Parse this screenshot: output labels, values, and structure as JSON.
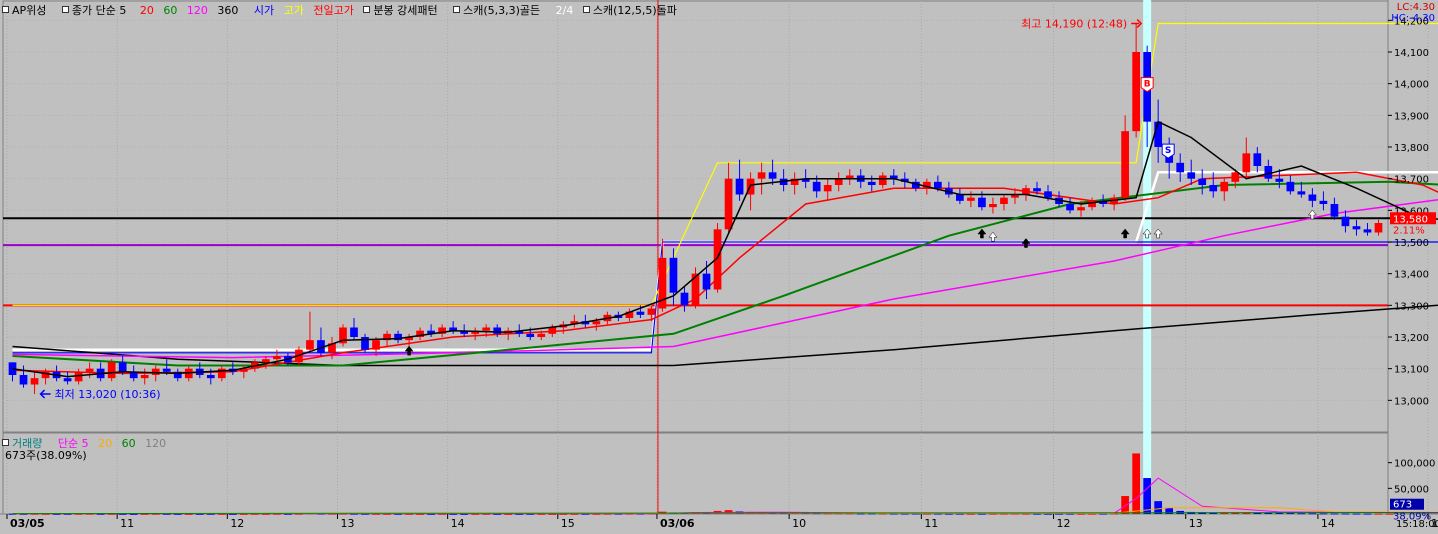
{
  "legend": {
    "indicator": "AP위성",
    "ma_label": "종가 단순 5",
    "ma20": "20",
    "ma60": "60",
    "ma120": "120",
    "ma360": "360",
    "open": "시가",
    "high": "고가",
    "prev_high": "전일고가",
    "pattern": "분봉 강세패턴",
    "scan1": "스캐(5,3,3)골든",
    "scan1_count": "2/4",
    "scan2": "스캐(12,5,5)돌파"
  },
  "right_info": {
    "lc": "LC:4.30",
    "hc": "HC:-4.30"
  },
  "colors": {
    "ma5": "#000000",
    "ma20": "#ff0000",
    "ma60": "#008000",
    "ma120": "#ff00ff",
    "ma360": "#000000",
    "open": "#0000ff",
    "high": "#ffff00",
    "prev_high": "#ff0000",
    "up": "#ff0000",
    "down": "#0000ff",
    "volume_label": "#008080"
  },
  "annotations": {
    "high_label": "최고 14,190 (12:48)",
    "low_label": "최저 13,020 (10:36)"
  },
  "markers": {
    "buy": "B",
    "sell": "S"
  },
  "current": {
    "price": "13,580",
    "change": "2.11%"
  },
  "volume_legend": {
    "title": "거래량",
    "ma_label": "단순 5",
    "ma20": "20",
    "ma60": "60",
    "ma120": "120"
  },
  "volume_info": "673주(38.09%)",
  "volume_current": {
    "value": "673",
    "pct": "38.09%"
  },
  "time_axis": {
    "end": "15:18:00"
  },
  "chart_data": [
    {
      "type": "candlestick",
      "x_labels": [
        "03/05",
        "11",
        "12",
        "13",
        "14",
        "15",
        "03/06",
        "10",
        "11",
        "12",
        "13",
        "14",
        "15"
      ],
      "y_ticks": [
        "14,200",
        "14,100",
        "14,000",
        "13,900",
        "13,800",
        "13,700",
        "13,600",
        "13,500",
        "13,400",
        "13,300",
        "13,200",
        "13,100",
        "13,000"
      ],
      "ylim": [
        12900,
        14220
      ],
      "candles": [
        [
          13120,
          13120,
          13060,
          13080
        ],
        [
          13080,
          13110,
          13040,
          13050
        ],
        [
          13050,
          13090,
          13020,
          13070
        ],
        [
          13070,
          13100,
          13050,
          13090
        ],
        [
          13090,
          13110,
          13060,
          13070
        ],
        [
          13070,
          13090,
          13050,
          13060
        ],
        [
          13060,
          13100,
          13050,
          13090
        ],
        [
          13090,
          13120,
          13070,
          13100
        ],
        [
          13100,
          13120,
          13060,
          13070
        ],
        [
          13070,
          13130,
          13060,
          13120
        ],
        [
          13120,
          13140,
          13080,
          13090
        ],
        [
          13090,
          13110,
          13060,
          13070
        ],
        [
          13070,
          13100,
          13050,
          13080
        ],
        [
          13080,
          13110,
          13060,
          13100
        ],
        [
          13100,
          13130,
          13080,
          13090
        ],
        [
          13090,
          13100,
          13060,
          13070
        ],
        [
          13070,
          13110,
          13060,
          13100
        ],
        [
          13100,
          13120,
          13070,
          13080
        ],
        [
          13080,
          13100,
          13050,
          13070
        ],
        [
          13070,
          13110,
          13060,
          13100
        ],
        [
          13100,
          13120,
          13080,
          13090
        ],
        [
          13090,
          13110,
          13070,
          13100
        ],
        [
          13100,
          13130,
          13090,
          13120
        ],
        [
          13120,
          13140,
          13100,
          13130
        ],
        [
          13130,
          13160,
          13110,
          13140
        ],
        [
          13140,
          13150,
          13110,
          13120
        ],
        [
          13120,
          13170,
          13110,
          13160
        ],
        [
          13160,
          13280,
          13150,
          13190
        ],
        [
          13190,
          13230,
          13140,
          13150
        ],
        [
          13150,
          13200,
          13130,
          13180
        ],
        [
          13180,
          13240,
          13170,
          13230
        ],
        [
          13230,
          13260,
          13190,
          13200
        ],
        [
          13200,
          13210,
          13150,
          13160
        ],
        [
          13160,
          13200,
          13140,
          13190
        ],
        [
          13190,
          13220,
          13170,
          13210
        ],
        [
          13210,
          13220,
          13180,
          13190
        ],
        [
          13190,
          13210,
          13170,
          13200
        ],
        [
          13200,
          13230,
          13190,
          13220
        ],
        [
          13220,
          13240,
          13200,
          13210
        ],
        [
          13210,
          13240,
          13200,
          13230
        ],
        [
          13230,
          13250,
          13210,
          13220
        ],
        [
          13220,
          13240,
          13200,
          13210
        ],
        [
          13210,
          13230,
          13190,
          13220
        ],
        [
          13220,
          13240,
          13200,
          13230
        ],
        [
          13230,
          13240,
          13200,
          13210
        ],
        [
          13210,
          13230,
          13190,
          13220
        ],
        [
          13220,
          13240,
          13200,
          13210
        ],
        [
          13210,
          13230,
          13190,
          13200
        ],
        [
          13200,
          13220,
          13190,
          13210
        ],
        [
          13210,
          13240,
          13200,
          13230
        ],
        [
          13230,
          13250,
          13210,
          13240
        ],
        [
          13240,
          13270,
          13230,
          13250
        ],
        [
          13250,
          13270,
          13230,
          13240
        ],
        [
          13240,
          13260,
          13220,
          13250
        ],
        [
          13250,
          13280,
          13240,
          13270
        ],
        [
          13270,
          13280,
          13250,
          13260
        ],
        [
          13260,
          13290,
          13250,
          13280
        ],
        [
          13280,
          13300,
          13260,
          13270
        ],
        [
          13270,
          13300,
          13250,
          13290
        ],
        [
          13290,
          13510,
          13280,
          13450
        ],
        [
          13450,
          13480,
          13300,
          13340
        ],
        [
          13340,
          13360,
          13280,
          13300
        ],
        [
          13300,
          13420,
          13290,
          13400
        ],
        [
          13400,
          13440,
          13320,
          13350
        ],
        [
          13350,
          13560,
          13340,
          13540
        ],
        [
          13540,
          13750,
          13530,
          13700
        ],
        [
          13700,
          13760,
          13630,
          13650
        ],
        [
          13650,
          13720,
          13600,
          13700
        ],
        [
          13700,
          13750,
          13650,
          13720
        ],
        [
          13720,
          13760,
          13680,
          13700
        ],
        [
          13700,
          13730,
          13660,
          13680
        ],
        [
          13680,
          13720,
          13650,
          13700
        ],
        [
          13700,
          13730,
          13670,
          13690
        ],
        [
          13690,
          13710,
          13640,
          13660
        ],
        [
          13660,
          13700,
          13630,
          13680
        ],
        [
          13680,
          13720,
          13660,
          13700
        ],
        [
          13700,
          13730,
          13680,
          13710
        ],
        [
          13710,
          13730,
          13670,
          13690
        ],
        [
          13690,
          13710,
          13660,
          13680
        ],
        [
          13680,
          13720,
          13670,
          13710
        ],
        [
          13710,
          13730,
          13680,
          13700
        ],
        [
          13700,
          13720,
          13670,
          13690
        ],
        [
          13690,
          13700,
          13660,
          13670
        ],
        [
          13670,
          13700,
          13650,
          13690
        ],
        [
          13690,
          13710,
          13660,
          13670
        ],
        [
          13670,
          13690,
          13640,
          13650
        ],
        [
          13650,
          13670,
          13620,
          13630
        ],
        [
          13630,
          13660,
          13610,
          13640
        ],
        [
          13640,
          13660,
          13600,
          13610
        ],
        [
          13610,
          13640,
          13590,
          13620
        ],
        [
          13620,
          13650,
          13600,
          13640
        ],
        [
          13640,
          13670,
          13620,
          13650
        ],
        [
          13650,
          13680,
          13630,
          13670
        ],
        [
          13670,
          13690,
          13650,
          13660
        ],
        [
          13660,
          13680,
          13630,
          13640
        ],
        [
          13640,
          13660,
          13610,
          13620
        ],
        [
          13620,
          13640,
          13590,
          13600
        ],
        [
          13600,
          13630,
          13580,
          13610
        ],
        [
          13610,
          13640,
          13600,
          13630
        ],
        [
          13630,
          13650,
          13610,
          13620
        ],
        [
          13620,
          13650,
          13600,
          13640
        ],
        [
          13640,
          13900,
          13630,
          13850
        ],
        [
          13850,
          14190,
          13830,
          14100
        ],
        [
          14100,
          14120,
          13800,
          13880
        ],
        [
          13880,
          13950,
          13750,
          13800
        ],
        [
          13800,
          13830,
          13700,
          13750
        ],
        [
          13750,
          13780,
          13690,
          13720
        ],
        [
          13720,
          13760,
          13680,
          13700
        ],
        [
          13700,
          13730,
          13650,
          13680
        ],
        [
          13680,
          13720,
          13640,
          13660
        ],
        [
          13660,
          13700,
          13630,
          13690
        ],
        [
          13690,
          13730,
          13670,
          13720
        ],
        [
          13720,
          13830,
          13700,
          13780
        ],
        [
          13780,
          13800,
          13720,
          13740
        ],
        [
          13740,
          13760,
          13690,
          13700
        ],
        [
          13700,
          13730,
          13670,
          13690
        ],
        [
          13690,
          13710,
          13650,
          13660
        ],
        [
          13660,
          13690,
          13640,
          13650
        ],
        [
          13650,
          13670,
          13610,
          13630
        ],
        [
          13630,
          13660,
          13600,
          13620
        ],
        [
          13620,
          13640,
          13570,
          13580
        ],
        [
          13580,
          13600,
          13530,
          13550
        ],
        [
          13550,
          13570,
          13520,
          13540
        ],
        [
          13540,
          13560,
          13520,
          13530
        ],
        [
          13530,
          13570,
          13520,
          13560
        ]
      ],
      "ma5": [
        [
          0,
          13100
        ],
        [
          5,
          13075
        ],
        [
          10,
          13090
        ],
        [
          15,
          13085
        ],
        [
          20,
          13095
        ],
        [
          25,
          13130
        ],
        [
          30,
          13190
        ],
        [
          35,
          13195
        ],
        [
          40,
          13220
        ],
        [
          45,
          13215
        ],
        [
          50,
          13235
        ],
        [
          55,
          13265
        ],
        [
          60,
          13330
        ],
        [
          64,
          13450
        ],
        [
          67,
          13680
        ],
        [
          72,
          13700
        ],
        [
          80,
          13700
        ],
        [
          86,
          13650
        ],
        [
          92,
          13650
        ],
        [
          97,
          13620
        ],
        [
          102,
          13640
        ],
        [
          104,
          13880
        ],
        [
          107,
          13830
        ],
        [
          112,
          13700
        ],
        [
          117,
          13740
        ],
        [
          122,
          13670
        ],
        [
          127,
          13590
        ],
        [
          133,
          13545
        ]
      ],
      "ma20": [
        [
          0,
          13095
        ],
        [
          10,
          13085
        ],
        [
          20,
          13090
        ],
        [
          30,
          13150
        ],
        [
          40,
          13200
        ],
        [
          50,
          13220
        ],
        [
          58,
          13255
        ],
        [
          62,
          13320
        ],
        [
          66,
          13450
        ],
        [
          72,
          13620
        ],
        [
          80,
          13670
        ],
        [
          90,
          13670
        ],
        [
          100,
          13620
        ],
        [
          104,
          13640
        ],
        [
          108,
          13700
        ],
        [
          115,
          13710
        ],
        [
          122,
          13720
        ],
        [
          128,
          13680
        ],
        [
          133,
          13600
        ]
      ],
      "ma60": [
        [
          0,
          13140
        ],
        [
          15,
          13110
        ],
        [
          30,
          13110
        ],
        [
          45,
          13160
        ],
        [
          60,
          13210
        ],
        [
          70,
          13330
        ],
        [
          85,
          13520
        ],
        [
          96,
          13620
        ],
        [
          103,
          13650
        ],
        [
          110,
          13680
        ],
        [
          125,
          13690
        ],
        [
          133,
          13675
        ]
      ],
      "ma120": [
        [
          0,
          13145
        ],
        [
          20,
          13135
        ],
        [
          40,
          13150
        ],
        [
          60,
          13170
        ],
        [
          80,
          13320
        ],
        [
          100,
          13440
        ],
        [
          110,
          13520
        ],
        [
          120,
          13590
        ],
        [
          133,
          13650
        ]
      ],
      "ma360": [
        [
          0,
          13170
        ],
        [
          15,
          13130
        ],
        [
          30,
          13110
        ],
        [
          60,
          13110
        ],
        [
          80,
          13160
        ],
        [
          100,
          13220
        ],
        [
          118,
          13270
        ],
        [
          133,
          13310
        ]
      ],
      "open_line": [
        [
          0,
          13150
        ],
        [
          58,
          13150
        ],
        [
          59,
          13500
        ],
        [
          133,
          13500
        ]
      ],
      "high_line": [
        [
          0,
          13300
        ],
        [
          58,
          13300
        ],
        [
          64,
          13750
        ],
        [
          102,
          13750
        ],
        [
          104,
          14190
        ],
        [
          133,
          14190
        ]
      ],
      "prev_high": 13300,
      "black_hline": 13575,
      "purple_hline": 13490,
      "white_line": [
        [
          0,
          13160
        ],
        [
          58,
          13160
        ],
        [
          59,
          13500
        ],
        [
          102,
          13500
        ],
        [
          104,
          13720
        ],
        [
          133,
          13720
        ]
      ]
    },
    {
      "type": "bar",
      "ylim": [
        0,
        150000
      ],
      "y_ticks": [
        "100,000",
        "50,000"
      ],
      "values": [
        500,
        300,
        400,
        300,
        200,
        300,
        400,
        500,
        300,
        400,
        300,
        200,
        300,
        500,
        400,
        300,
        200,
        300,
        400,
        300,
        200,
        300,
        400,
        300,
        500,
        400,
        600,
        1500,
        900,
        700,
        800,
        600,
        500,
        400,
        300,
        400,
        300,
        200,
        300,
        400,
        300,
        200,
        300,
        400,
        300,
        200,
        300,
        400,
        300,
        200,
        300,
        400,
        500,
        400,
        600,
        700,
        800,
        900,
        1200,
        4500,
        3000,
        2500,
        3500,
        2800,
        6000,
        7500,
        5000,
        4000,
        3800,
        3000,
        2500,
        2200,
        2000,
        1800,
        1500,
        1600,
        1400,
        1200,
        1300,
        1100,
        1000,
        900,
        1000,
        800,
        900,
        700,
        800,
        600,
        700,
        800,
        900,
        1000,
        800,
        700,
        600,
        700,
        800,
        600,
        700,
        900,
        1200,
        35000,
        118000,
        70000,
        25000,
        12000,
        6000,
        4000,
        3500,
        3000,
        2800,
        2500,
        2200,
        2600,
        2400,
        2000,
        1800,
        1500,
        1400,
        1200,
        1100,
        1000,
        900,
        800,
        700,
        673
      ]
    }
  ]
}
